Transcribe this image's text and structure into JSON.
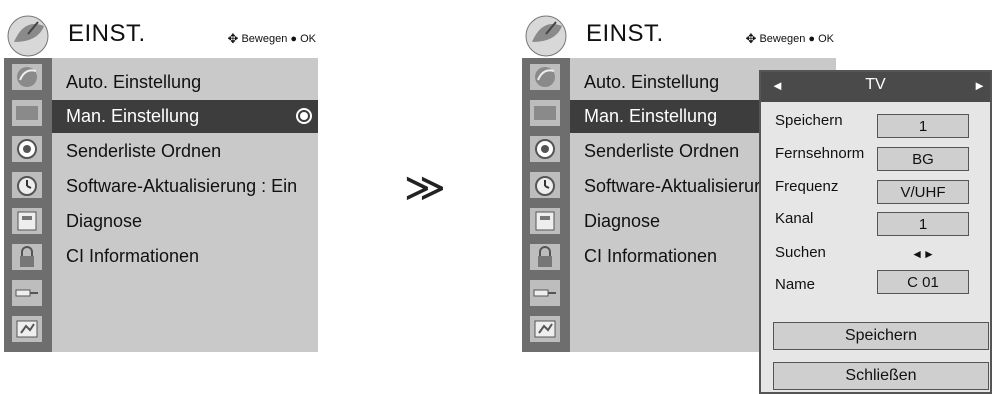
{
  "menu": {
    "title": "EINST.",
    "hint_move": "Bewegen",
    "hint_ok": "OK",
    "left_items": [
      "Auto. Einstellung",
      "Man. Einstellung",
      "Senderliste Ordnen",
      "Software-Aktualisierung : Ein",
      "Diagnose",
      "CI Informationen"
    ],
    "right_items": [
      "Auto. Einstellung",
      "Man. Einstellung",
      "Senderliste Ordnen",
      "Software-Aktualisierur",
      "Diagnose",
      "CI Informationen"
    ],
    "selected_index": 1
  },
  "arrow_glyph": "≫",
  "dialog": {
    "title": "TV",
    "rows": {
      "speichern_label": "Speichern",
      "speichern_value": "1",
      "fernsehnorm_label": "Fernsehnorm",
      "fernsehnorm_value": "BG",
      "frequenz_label": "Frequenz",
      "frequenz_value": "V/UHF",
      "kanal_label": "Kanal",
      "kanal_value": "1",
      "suchen_label": "Suchen",
      "suchen_value": "◄►",
      "name_label": "Name",
      "name_value": "C 01"
    },
    "save_button": "Speichern",
    "close_button": "Schließen"
  },
  "colors": {
    "panel": "#c9c9c9",
    "icon_column": "#6e6e6e",
    "selected": "#3d3d3d",
    "dialog_bg": "#e6e6e6",
    "dialog_header": "#4a4a4a"
  }
}
